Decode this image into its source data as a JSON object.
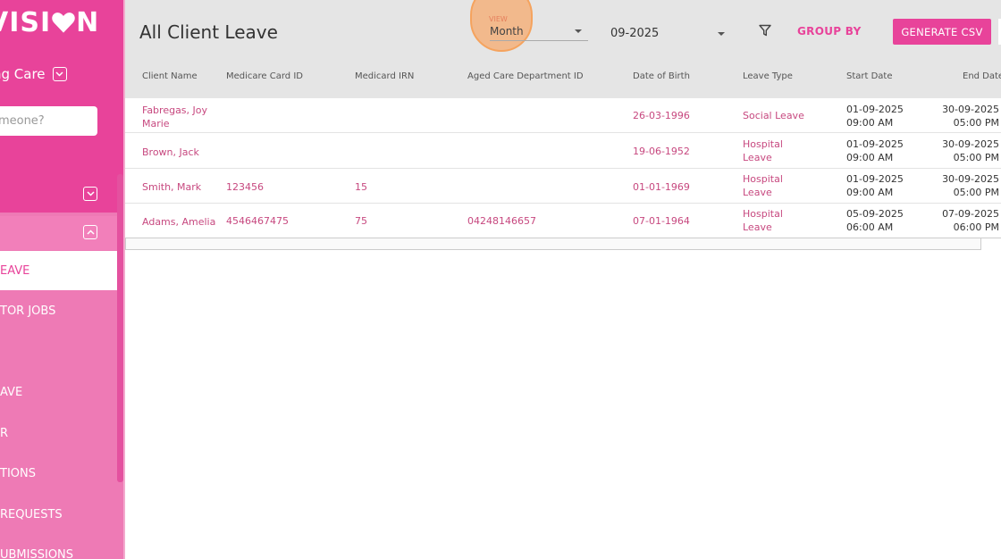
{
  "sidebar": {
    "logo_text": "VISI",
    "logo_tail": "N",
    "org_name": "ng Care",
    "search_placeholder": "omeone?",
    "active_item": "EAVE",
    "items": [
      "TOR JOBS",
      "AVE",
      "R",
      "TIONS",
      "REQUESTS",
      "UBMISSIONS"
    ]
  },
  "header": {
    "title": "All Client Leave",
    "view_label": "VIEW",
    "view_value": "Month",
    "month_value": "09-2025",
    "group_by_label": "GROUP BY",
    "csv_button": "GENERATE CSV"
  },
  "columns": [
    "Client Name",
    "Medicare Card ID",
    "Medicard IRN",
    "Aged Care Department ID",
    "Date of Birth",
    "Leave Type",
    "Start Date",
    "End Date"
  ],
  "rows": [
    {
      "client_line1": "Fabregas, Joy",
      "client_line2": "Marie",
      "medicare_id": "",
      "irn": "",
      "aged_care_id": "",
      "dob": "26-03-1996",
      "leave_line1": "Social Leave",
      "leave_line2": "",
      "start_date": "01-09-2025",
      "start_time": "09:00 AM",
      "end_date": "30-09-2025",
      "end_time": "05:00 PM"
    },
    {
      "client_line1": "Brown, Jack",
      "client_line2": "",
      "medicare_id": "",
      "irn": "",
      "aged_care_id": "",
      "dob": "19-06-1952",
      "leave_line1": "Hospital",
      "leave_line2": "Leave",
      "start_date": "01-09-2025",
      "start_time": "09:00 AM",
      "end_date": "30-09-2025",
      "end_time": "05:00 PM"
    },
    {
      "client_line1": "Smith, Mark",
      "client_line2": "",
      "medicare_id": "123456",
      "irn": "15",
      "aged_care_id": "",
      "dob": "01-01-1969",
      "leave_line1": "Hospital",
      "leave_line2": "Leave",
      "start_date": "01-09-2025",
      "start_time": "09:00 AM",
      "end_date": "30-09-2025",
      "end_time": "05:00 PM"
    },
    {
      "client_line1": "Adams, Amelia",
      "client_line2": "",
      "medicare_id": "4546467475",
      "irn": "75",
      "aged_care_id": "04248146657",
      "dob": "07-01-1964",
      "leave_line1": "Hospital",
      "leave_line2": "Leave",
      "start_date": "05-09-2025",
      "start_time": "06:00 AM",
      "end_date": "07-09-2025",
      "end_time": "06:00 PM"
    }
  ],
  "colors": {
    "brand": "#e8439a",
    "sidebar_light": "#ee7ab5",
    "link_text": "#c7487f",
    "header_bg": "#e5e5e5"
  }
}
